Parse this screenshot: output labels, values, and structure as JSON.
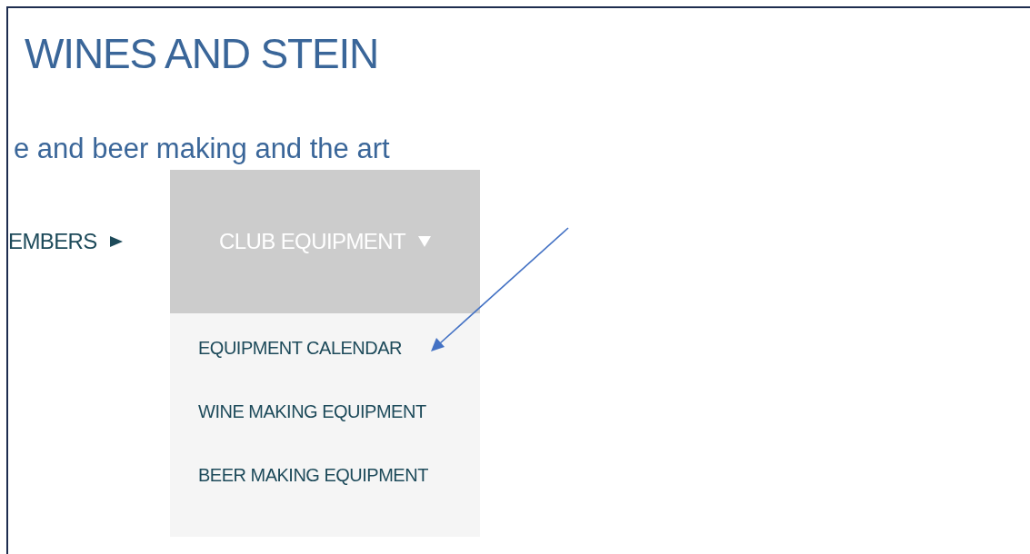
{
  "site_title": "WINES AND STEIN",
  "tagline": "e and beer making and the art",
  "nav": [
    {
      "label": "EMBERS",
      "kind": "submenu",
      "expanded": false
    },
    {
      "label": "CLUB EQUIPMENT",
      "kind": "dropdown",
      "expanded": true,
      "children": [
        {
          "label": "EQUIPMENT CALENDAR"
        },
        {
          "label": "WINE MAKING EQUIPMENT"
        },
        {
          "label": "BEER MAKING EQUIPMENT"
        }
      ]
    }
  ]
}
